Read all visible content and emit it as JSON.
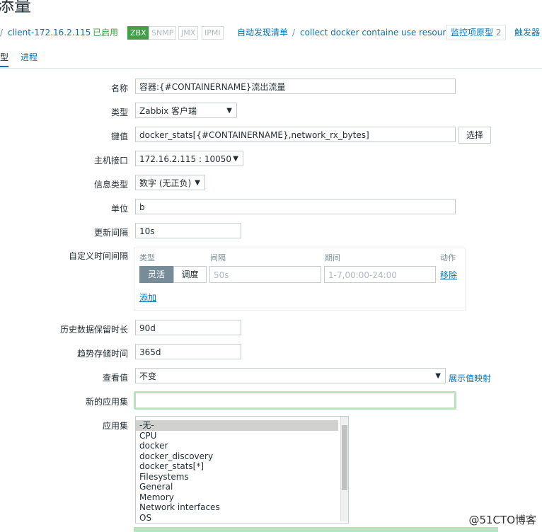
{
  "browser": {
    "title_fragment": "添量"
  },
  "breadcrumb": {
    "host": "client-172.16.2.115",
    "status": "已启用",
    "badges": [
      "ZBX",
      "SNMP",
      "JMX",
      "IPMI"
    ],
    "discovery": "自动发现清单",
    "rule": "collect docker containe use resource",
    "prototype_label": "监控项原型",
    "prototype_count": "2",
    "triggers": "触发器"
  },
  "tabs": [
    "型",
    "进程"
  ],
  "form": {
    "name": {
      "label": "名称",
      "value": "容器:{#CONTAINERNAME}流出流量"
    },
    "type": {
      "label": "类型",
      "value": "Zabbix 客户端"
    },
    "key": {
      "label": "键值",
      "value": "docker_stats[{#CONTAINERNAME},network_rx_bytes]",
      "button": "选择"
    },
    "interface": {
      "label": "主机接口",
      "value": "172.16.2.115 : 10050"
    },
    "info_type": {
      "label": "信息类型",
      "value": "数字 (无正负)"
    },
    "units": {
      "label": "单位",
      "value": "b"
    },
    "interval": {
      "label": "更新间隔",
      "value": "10s"
    },
    "custom_intervals": {
      "label": "自定义时间间隔",
      "col_type": "类型",
      "col_interval": "间隔",
      "col_period": "期间",
      "col_action": "动作",
      "flex": "灵活",
      "schedule": "调度",
      "interval_placeholder": "50s",
      "period_placeholder": "1-7,00:00-24:00",
      "remove": "移除",
      "add": "添加"
    },
    "history": {
      "label": "历史数据保留时长",
      "value": "90d"
    },
    "trends": {
      "label": "趋势存储时间",
      "value": "365d"
    },
    "show_value": {
      "label": "查看值",
      "value": "不变",
      "link": "展示值映射"
    },
    "new_app": {
      "label": "新的应用集",
      "value": ""
    },
    "apps": {
      "label": "应用集",
      "items": [
        "-无-",
        "CPU",
        "docker",
        "docker_discovery",
        "docker_stats[*]",
        "Filesystems",
        "General",
        "Memory",
        "Network interfaces",
        "OS"
      ]
    }
  },
  "watermark": "@51CTO博客"
}
